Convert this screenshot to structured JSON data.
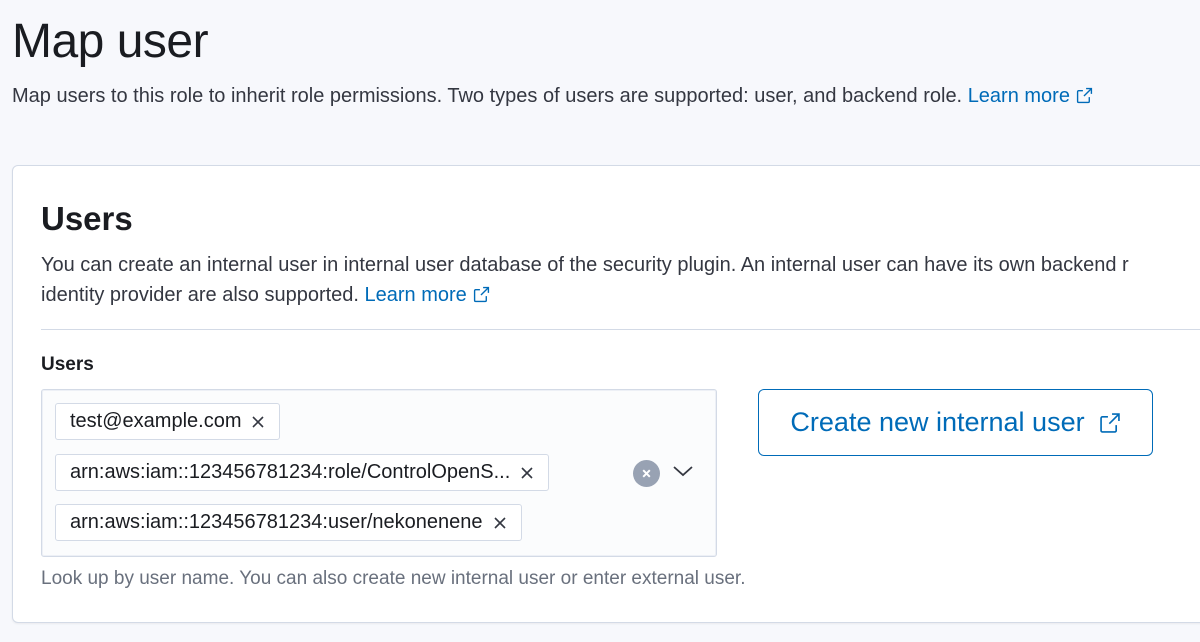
{
  "header": {
    "title": "Map user",
    "description": "Map users to this role to inherit role permissions. Two types of users are supported: user, and backend role.",
    "learn_more": "Learn more"
  },
  "panel": {
    "title": "Users",
    "description_line1": "You can create an internal user in internal user database of the security plugin. An internal user can have its own backend r",
    "description_line2": "identity provider are also supported.",
    "learn_more": "Learn more"
  },
  "users_field": {
    "label": "Users",
    "selected": [
      "test@example.com",
      "arn:aws:iam::123456781234:role/ControlOpenS...",
      "arn:aws:iam::123456781234:user/nekonenene"
    ],
    "help_text": "Look up by user name. You can also create new internal user or enter external user."
  },
  "create_button": {
    "label": "Create new internal user"
  },
  "colors": {
    "link": "#006bb8",
    "border": "#d3dae6",
    "background": "#f7f8fc"
  },
  "icons": {
    "external_link": "external-link-icon",
    "remove": "cross-icon",
    "clear": "clear-icon",
    "dropdown": "chevron-down-icon"
  }
}
